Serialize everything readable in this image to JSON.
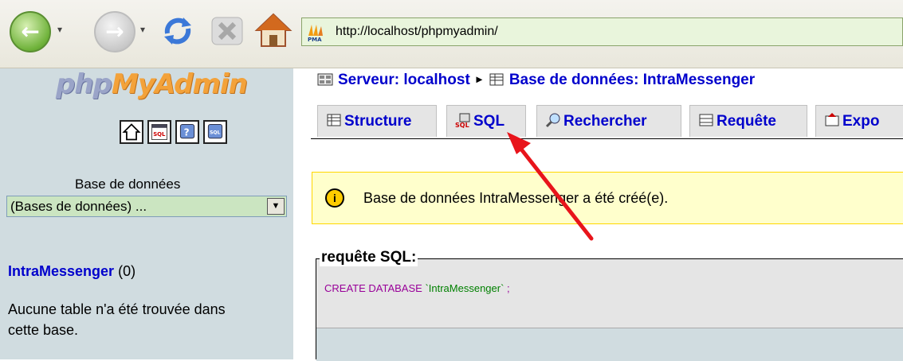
{
  "browser": {
    "url": "http://localhost/phpmyadmin/",
    "dropdown_glyph": "▾",
    "back_icon": "back-arrow",
    "forward_icon": "forward-arrow"
  },
  "sidebar": {
    "logo_php": "php",
    "logo_myadmin": "MyAdmin",
    "db_label": "Base de données",
    "db_select_value": "(Bases de données) ...",
    "db_name": "IntraMessenger",
    "db_count": "(0)",
    "no_tables": "Aucune table n'a été trouvée dans cette base."
  },
  "header": {
    "server": "Serveur: localhost",
    "database": "Base de données: IntraMessenger",
    "separator": "▸"
  },
  "tabs": [
    {
      "label": "Structure"
    },
    {
      "label": "SQL"
    },
    {
      "label": "Rechercher"
    },
    {
      "label": "Requête"
    },
    {
      "label": "Expo"
    }
  ],
  "notice": {
    "icon_text": "i",
    "message": "Base de données IntraMessenger a été créé(e)."
  },
  "sql": {
    "legend": "requête SQL:",
    "keyword": "CREATE DATABASE",
    "identifier": "`IntraMessenger`",
    "terminator": ";"
  },
  "colors": {
    "link": "#0000cc",
    "sidebar_bg": "#d0dce0",
    "notice_bg": "#ffffcc",
    "annotation_arrow": "#e8141b"
  }
}
